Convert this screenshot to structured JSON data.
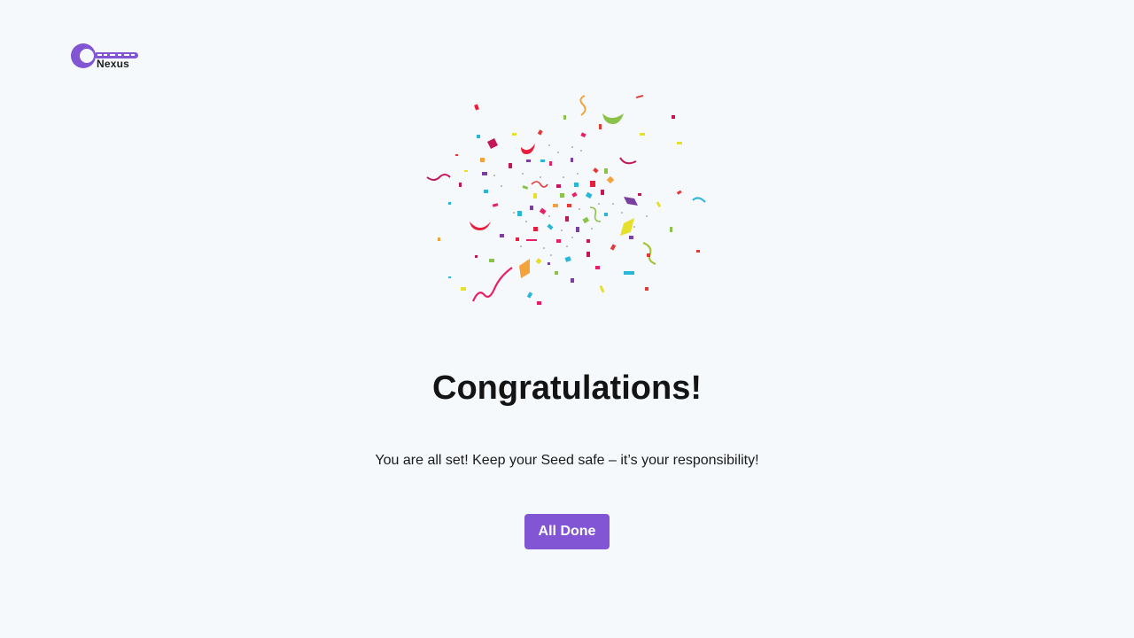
{
  "brand": {
    "name": "Nexus",
    "logo_icon": "key-icon",
    "accent_color": "#8155d4"
  },
  "illustration": {
    "icon": "confetti-icon"
  },
  "main": {
    "title": "Congratulations!",
    "subtitle": "You are all set! Keep your Seed safe – it’s your responsibility!",
    "done_label": "All Done"
  }
}
